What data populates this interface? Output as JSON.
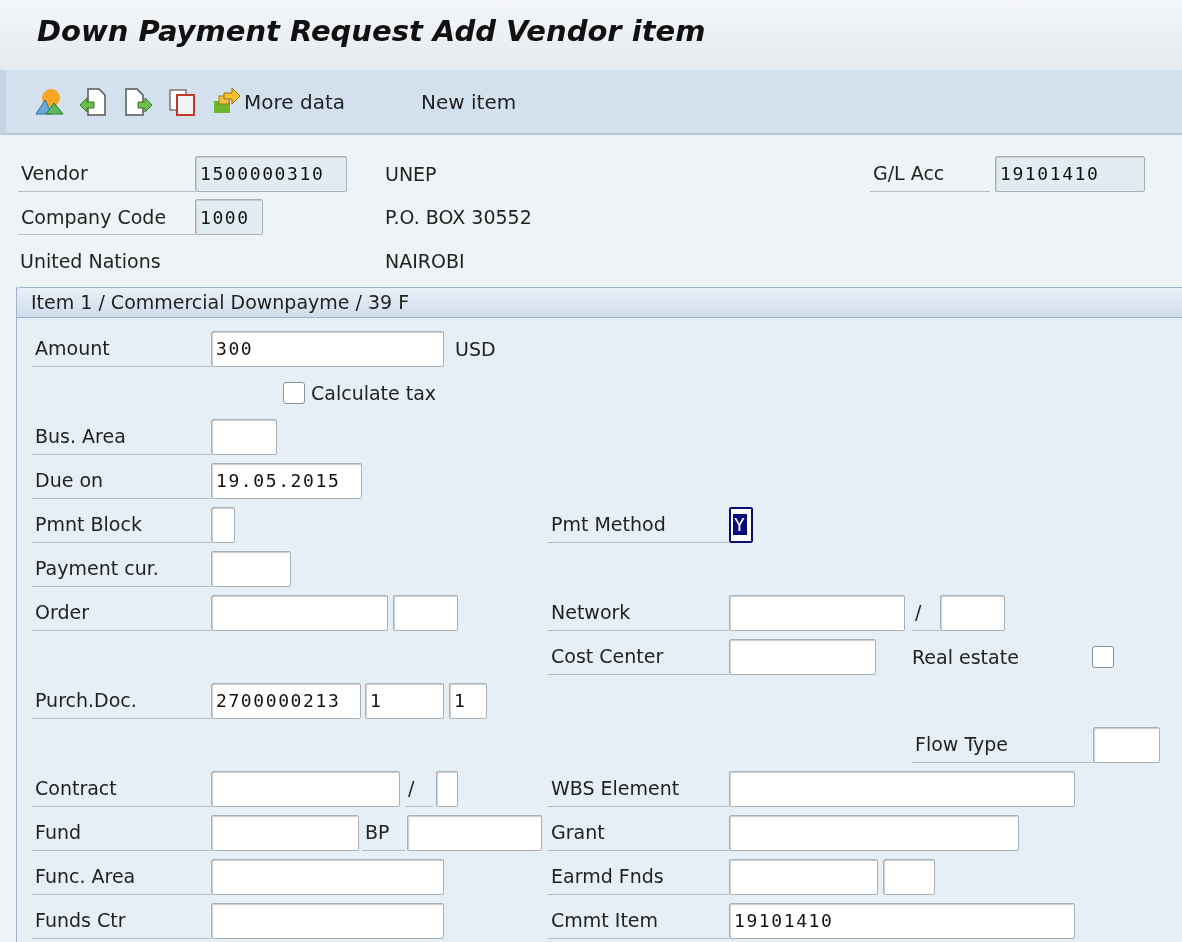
{
  "window": {
    "title": "Down Payment Request Add Vendor item"
  },
  "toolbar": {
    "buttons": [
      {
        "label": "More data"
      },
      {
        "label": "New item"
      }
    ]
  },
  "header": {
    "rows": [
      [
        {
          "kind": "label",
          "text": "Vendor"
        },
        {
          "kind": "field",
          "value": "1500000310",
          "readonly": true,
          "selected": false
        },
        {
          "kind": "text",
          "text": "UNEP"
        },
        {
          "kind": "label",
          "text": "G/L Acc"
        },
        {
          "kind": "field",
          "value": "19101410",
          "readonly": true,
          "selected": false
        }
      ],
      [
        {
          "kind": "label",
          "text": "Company Code"
        },
        {
          "kind": "field",
          "value": "1000",
          "readonly": true,
          "selected": false
        },
        {
          "kind": "text",
          "text": "P.O. BOX 30552"
        }
      ],
      [
        {
          "kind": "text",
          "text": "United Nations"
        },
        "",
        {
          "kind": "text",
          "text": "NAIROBI"
        }
      ]
    ]
  },
  "item_panel": {
    "title": "Item 1 / Commercial Downpayme / 39 F",
    "rows": [
      [
        {
          "kind": "label",
          "text": "Amount"
        },
        {
          "kind": "field",
          "value": "300",
          "readonly": false,
          "selected": false
        },
        "",
        {
          "kind": "text",
          "text": "USD"
        }
      ],
      [
        "",
        {
          "kind": "checkbox",
          "checked": false
        },
        {
          "kind": "text",
          "text": "Calculate tax"
        }
      ],
      [
        {
          "kind": "label",
          "text": "Bus. Area"
        },
        {
          "kind": "field",
          "readonly": false,
          "selected": false
        }
      ],
      [
        {
          "kind": "label",
          "text": "Due on"
        },
        {
          "kind": "field",
          "value": "19.05.2015",
          "readonly": false,
          "selected": false
        }
      ],
      [
        {
          "kind": "label",
          "text": "Pmnt Block"
        },
        {
          "kind": "field",
          "readonly": false,
          "selected": false
        },
        "",
        "",
        {
          "kind": "label",
          "text": "Pmt Method"
        },
        {
          "kind": "field",
          "value": "Y",
          "readonly": false,
          "selected": true
        }
      ],
      [
        {
          "kind": "label",
          "text": "Payment cur."
        },
        {
          "kind": "field",
          "readonly": false,
          "selected": false
        }
      ],
      [
        {
          "kind": "label",
          "text": "Order"
        },
        {
          "kind": "field",
          "readonly": false,
          "selected": false
        },
        {
          "kind": "field",
          "readonly": false,
          "selected": false
        },
        "",
        {
          "kind": "label",
          "text": "Network"
        },
        {
          "kind": "field",
          "readonly": false,
          "selected": false
        },
        {
          "kind": "label",
          "text": "/"
        },
        {
          "kind": "field",
          "readonly": false,
          "selected": false
        }
      ],
      [
        "",
        "",
        "",
        "",
        {
          "kind": "label",
          "text": "Cost Center"
        },
        {
          "kind": "field",
          "readonly": false,
          "selected": false
        },
        {
          "kind": "text",
          "text": "Real estate"
        },
        {
          "kind": "checkbox",
          "checked": false
        }
      ],
      [
        {
          "kind": "label",
          "text": "Purch.Doc."
        },
        {
          "kind": "field",
          "value": "2700000213",
          "readonly": false,
          "selected": false
        },
        {
          "kind": "field",
          "value": "1",
          "readonly": false,
          "selected": false
        },
        {
          "kind": "field",
          "value": "1",
          "readonly": false,
          "selected": false
        }
      ],
      [
        "",
        "",
        "",
        "",
        "",
        "",
        {
          "kind": "label",
          "text": "Flow Type"
        },
        {
          "kind": "field",
          "readonly": false,
          "selected": false
        }
      ],
      [
        {
          "kind": "label",
          "text": "Contract"
        },
        {
          "kind": "field",
          "readonly": false,
          "selected": false
        },
        {
          "kind": "label",
          "text": "/"
        },
        {
          "kind": "field",
          "readonly": false,
          "selected": false
        },
        {
          "kind": "label",
          "text": "WBS Element"
        },
        {
          "kind": "field",
          "readonly": false,
          "selected": false
        }
      ],
      [
        {
          "kind": "label",
          "text": "Fund"
        },
        {
          "kind": "field",
          "readonly": false,
          "selected": false
        },
        {
          "kind": "label",
          "text": "BP"
        },
        {
          "kind": "field",
          "readonly": false,
          "selected": false
        },
        {
          "kind": "label",
          "text": "Grant"
        },
        {
          "kind": "field",
          "readonly": false,
          "selected": false
        }
      ],
      [
        {
          "kind": "label",
          "text": "Func. Area"
        },
        {
          "kind": "field",
          "readonly": false,
          "selected": false
        },
        "",
        "",
        {
          "kind": "label",
          "text": "Earmd Fnds"
        },
        {
          "kind": "field",
          "readonly": false,
          "selected": false
        },
        {
          "kind": "field",
          "readonly": false,
          "selected": false
        }
      ],
      [
        {
          "kind": "label",
          "text": "Funds Ctr"
        },
        {
          "kind": "field",
          "readonly": false,
          "selected": false
        },
        "",
        "",
        {
          "kind": "label",
          "text": "Cmmt Item"
        },
        {
          "kind": "field",
          "value": "19101410",
          "readonly": false,
          "selected": false
        }
      ]
    ]
  }
}
